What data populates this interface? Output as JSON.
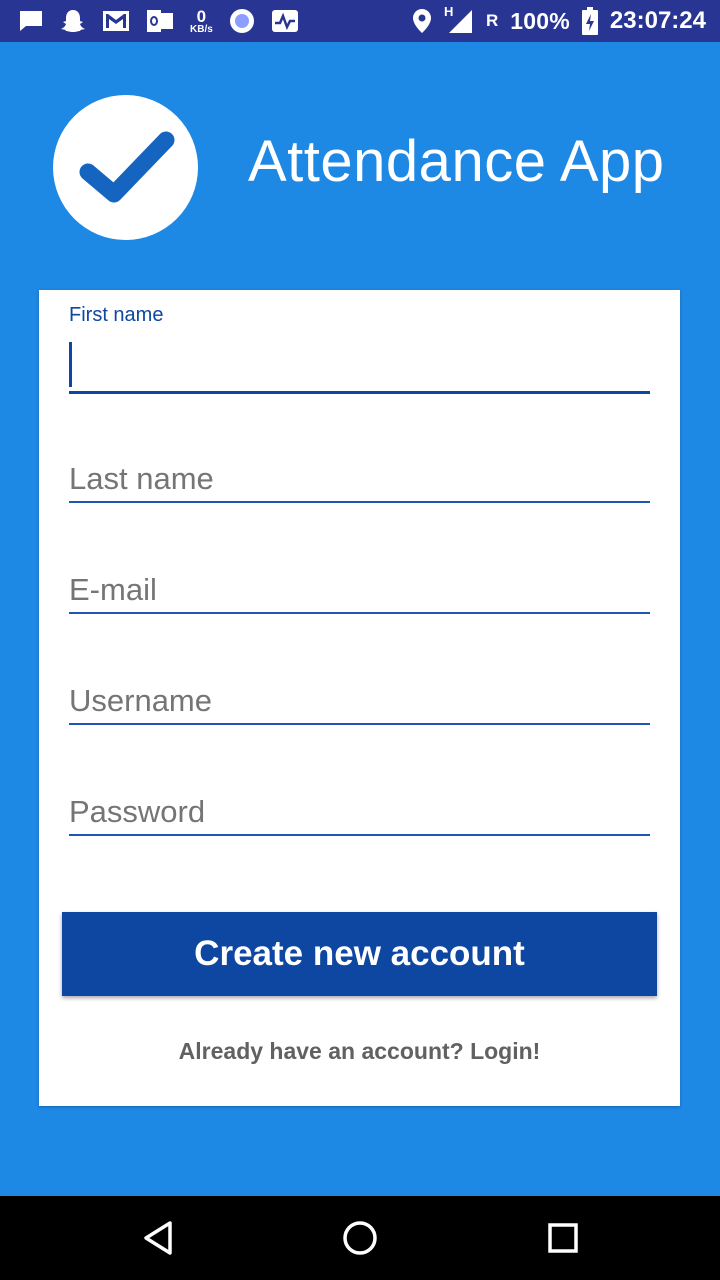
{
  "status_bar": {
    "icons_left": [
      "message-icon",
      "snapchat-icon",
      "gmail-icon",
      "outlook-icon",
      "data-speed",
      "record-icon",
      "activity-icon"
    ],
    "data_speed_value": "0",
    "data_speed_unit": "KB/s",
    "icons_right": [
      "location-icon",
      "signal-icon"
    ],
    "network_type": "H",
    "roaming": "R",
    "battery_percent": "100%",
    "time": "23:07:24"
  },
  "header": {
    "app_title": "Attendance App",
    "logo_icon": "checkmark-icon"
  },
  "form": {
    "first_name": {
      "label": "First name",
      "value": ""
    },
    "last_name": {
      "placeholder": "Last name",
      "value": ""
    },
    "email": {
      "placeholder": "E-mail",
      "value": ""
    },
    "username": {
      "placeholder": "Username",
      "value": ""
    },
    "password": {
      "placeholder": "Password",
      "value": ""
    },
    "submit_label": "Create new account",
    "login_link": "Already have an account? Login!"
  },
  "nav_bar": {
    "buttons": [
      "back-icon",
      "home-icon",
      "recents-icon"
    ]
  },
  "colors": {
    "background": "#1E88E5",
    "status_bar": "#283593",
    "accent": "#0D47A1",
    "card": "#FFFFFF"
  }
}
